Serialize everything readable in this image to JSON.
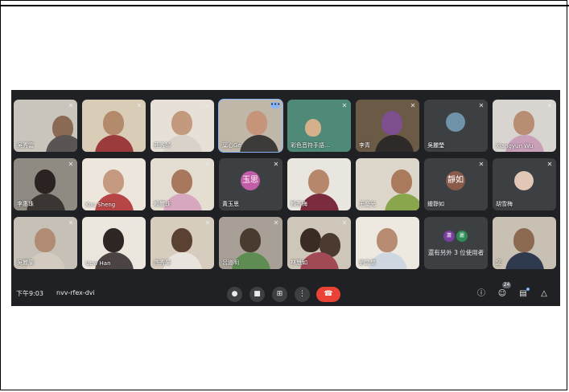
{
  "meeting": {
    "time": "下午9:03",
    "code": "nvv-rfex-dvi",
    "participants_count": "24",
    "others_label": "還有另外 3 位使用者"
  },
  "tiles": [
    {
      "name": "吳秀雲"
    },
    {
      "name": ""
    },
    {
      "name": "莊秀琴"
    },
    {
      "name": "葉心Ge"
    },
    {
      "name": "彩色音符手語…"
    },
    {
      "name": "李青"
    },
    {
      "name": "吳麗瑩"
    },
    {
      "name": "Xiangyun Wu"
    },
    {
      "name": "李惠珠"
    },
    {
      "name": "Kou Sheng"
    },
    {
      "name": "賴麗珠"
    },
    {
      "name": "黃玉思",
      "avatar": "玉思"
    },
    {
      "name": "賴秀梅"
    },
    {
      "name": "王慶光"
    },
    {
      "name": "鍾靜如",
      "avatar": "靜如"
    },
    {
      "name": "胡雪梅"
    },
    {
      "name": "吳麗蘭"
    },
    {
      "name": "Upw Han"
    },
    {
      "name": "許秀蘭"
    },
    {
      "name": "呂道明"
    },
    {
      "name": "林慧如"
    },
    {
      "name": "劉念慈"
    },
    {
      "name": "",
      "others": true,
      "av1": "蕭",
      "av2": "麗"
    },
    {
      "name": "您"
    }
  ],
  "colors": {
    "background": "#202124",
    "tile": "#3c4043",
    "hangup": "#ea4335",
    "accent": "#8ab4f8"
  }
}
